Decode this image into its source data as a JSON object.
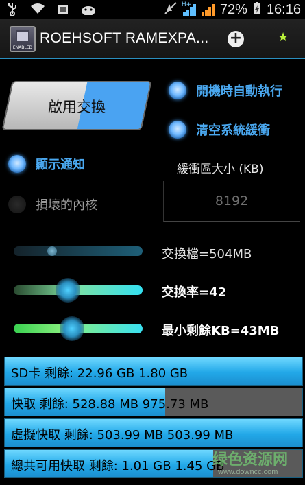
{
  "status_bar": {
    "battery": "72%",
    "time": "16:16",
    "network_label": "H+"
  },
  "action_bar": {
    "app_icon_label": "ENABLED",
    "title": "ROEHSOFT RAMEXPA...",
    "add_symbol": "+",
    "star_symbol": "★"
  },
  "main": {
    "swap_button": "啟用交換",
    "autostart_label": "開機時自動執行",
    "clear_cache_label": "清空系統緩衝",
    "show_notification_label": "顯示通知",
    "broken_kernel_label": "損壞的內核",
    "buffer_size_label": "緩衝區大小 (KB)",
    "buffer_size_value": "8192",
    "sliders": [
      {
        "label": "交換檔=504MB",
        "level": 0.3
      },
      {
        "label": "交換率=42",
        "level": 0.42
      },
      {
        "label": "最小剩餘KB=43MB",
        "level": 0.45
      }
    ],
    "storage": [
      {
        "text": "SD卡 剩餘: 22.96 GB 1.80 GB",
        "fill": 1.0
      },
      {
        "text": "快取 剩餘: 528.88 MB 975.73 MB",
        "fill": 0.54
      },
      {
        "text": "虛擬快取 剩餘: 503.99 MB 503.99 MB",
        "fill": 1.0
      },
      {
        "text": "總共可用快取 剩餘: 1.01 GB 1.45 GB",
        "fill": 0.7
      }
    ],
    "watermark": "绿色资源网",
    "watermark_url": "www.downcc.com"
  },
  "colors": {
    "accent": "#4aa3f2",
    "radio_on_label": "#4aa8f0",
    "storage_fill": "#22a8e8"
  }
}
